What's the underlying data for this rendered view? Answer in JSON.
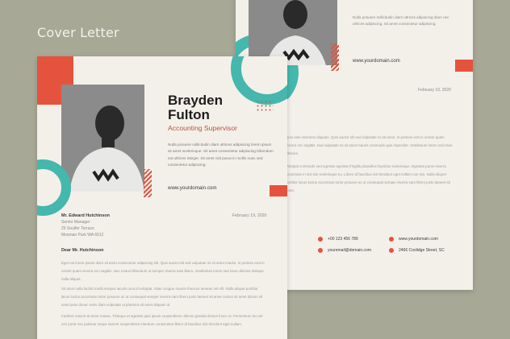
{
  "heading": "Cover Letter",
  "colors": {
    "accent_orange": "#e5533e",
    "accent_teal": "#45b7ad",
    "paper": "#f3f0e9",
    "background": "#a8a896"
  },
  "back_page": {
    "intro": "Nulla posuere sollicitudin diam ultrices adipiscing diam nec ultrices adipiscing. Sit amet consectetur adipiscing.",
    "url": "www.yourdomain.com",
    "date": "February 19, 2020",
    "para1": "Quis ante interdum aliquam. Quis auctor elit sed vulputate mi sit amet. In pretium erat in ornare quam viverra orci sagittis. Sed vulputate mi sit amet mauris commodo quis imperdiet. Vestibulum lorem sed risus ultricies.",
    "para2": "Volutpat commodo sed egestas egestas fringilla phasellus faucibus scelerisque. Egestas purus viverra accumsan in nisl nisi scelerisque eu. Libero id faucibus nisl tincidunt eget nullam non nisi. Nulla aliquet porttitor lacus luctus accumsan tortor posuere ac ut consequat semper viverra nam libero justo laoreet sit amet.",
    "contacts": [
      {
        "icon": "phone-icon",
        "text": "+00 123 456 789"
      },
      {
        "icon": "globe-icon",
        "text": "www.yourdomain.com"
      },
      {
        "icon": "mail-icon",
        "text": "youremail@domain.com"
      },
      {
        "icon": "location-icon",
        "text": "2466 Coolidge Street, SC"
      }
    ]
  },
  "front_page": {
    "name_line1": "Brayden",
    "name_line2": "Fulton",
    "role": "Accounting Supervisor",
    "intro": "Nulla posuere sollicitudin diam ultrices adipiscing lorem ipsum sit amet scelerisque. Sit amet consectetur adipiscing bibendum est ultrices integer. Sit amet nisl purus in mollis nunc sed consectetur adipiscing.",
    "url": "www.yourdomain.com",
    "recipient": {
      "name": "Mr. Edward Hutchinson",
      "title": "Senior Manager",
      "street": "29 Soulfer Terrace",
      "city": "Mosman Park WA 6012"
    },
    "date": "February 19, 2020",
    "salutation": "Dear Mr. Hutchinson",
    "para1": "Eget est lorem ipsum dolor sit amet consectetur adipiscing elit. Quis auctor elit sed vulputate mi sit amet mauris. In pretium erat in ornare quam viverra orci sagittis. Nec metus bibendum ut semper viverra nam libero. Vestibulum lorem sed risus ultricies tristique nulla aliquet.",
    "para2": "Sit amet nulla facilisi morbi tempus iaculis urna id volutpat. Vitae congue mauris rhoncus aenean vel elit. Nulla aliquet porttitor lacus luctus accumsan tortor posuere ac ut consequat semper viverra nam libero justo laoreet sit amet cursus sit amet dictum sit amet justo donec enim diam vulputate ut pharetra sit amet aliquam id.",
    "para3": "Facilisis mauris sit amet massa. Tristique et egestas quis ipsum suspendisse ultrices gravida dictum fusce ut. Fermentum leo vel orci porta non pulvinar neque laoreet suspendisse interdum consectetur libero id faucibus nisl tincidunt eget nullam."
  }
}
